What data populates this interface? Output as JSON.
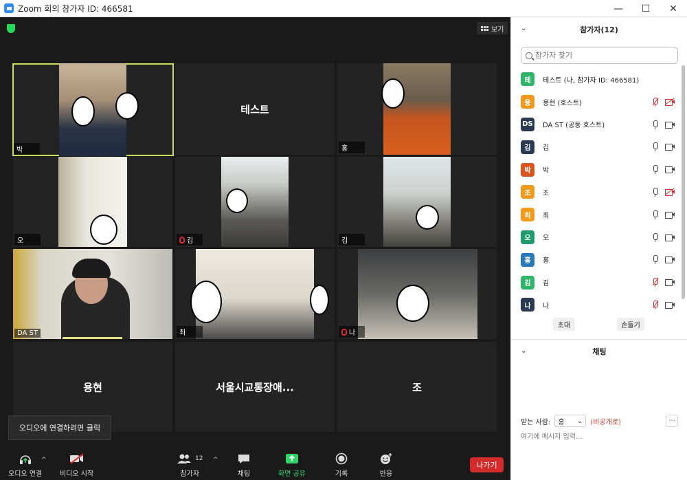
{
  "window": {
    "title": "Zoom 회의 참가자 ID: 466581",
    "controls": [
      "—",
      "☐",
      "✕"
    ]
  },
  "meeting": {
    "view_label": "보기",
    "tiles": [
      {
        "label": "박",
        "muted": false,
        "active": true,
        "type": "video"
      },
      {
        "center_name": "테스트",
        "type": "name"
      },
      {
        "label": "홍",
        "muted": false,
        "type": "video"
      },
      {
        "label": "오",
        "muted": false,
        "type": "video"
      },
      {
        "label": "김",
        "muted": true,
        "type": "video"
      },
      {
        "label": "김",
        "muted": false,
        "type": "video"
      },
      {
        "label": "DA ST",
        "muted": false,
        "type": "video",
        "talking": true
      },
      {
        "label": "최",
        "muted": false,
        "type": "video"
      },
      {
        "label": "나",
        "muted": true,
        "type": "video"
      },
      {
        "center_name": "용현",
        "type": "name"
      },
      {
        "center_name": "서울시교통장애...",
        "type": "name"
      },
      {
        "center_name": "조",
        "type": "name"
      }
    ]
  },
  "tooltip": "오디오에 연결하려면 클릭",
  "toolbar": {
    "audio": "오디오 연결",
    "video": "비디오 시작",
    "participants": "참가자",
    "participants_count": "12",
    "chat": "채팅",
    "share": "화면 공유",
    "record": "기록",
    "reactions": "반응",
    "leave": "나가기"
  },
  "panel": {
    "title": "참가자(12)",
    "search_placeholder": "참가자 찾기",
    "participants": [
      {
        "avatar": "테",
        "color": "#2fb66b",
        "name": "테스트 (나, 참가자 ID: 466581)",
        "mic": "none",
        "cam": "none"
      },
      {
        "avatar": "용",
        "color": "#f29a1b",
        "name": "용현 (호스트)",
        "mic": "off",
        "cam": "off"
      },
      {
        "avatar": "DS",
        "color": "#2a3c52",
        "name": "DA ST (공동 호스트)",
        "mic": "on",
        "cam": "on"
      },
      {
        "avatar": "김",
        "color": "#2a3c52",
        "name": "김",
        "mic": "on",
        "cam": "on"
      },
      {
        "avatar": "박",
        "color": "#d9541e",
        "name": "박",
        "mic": "on",
        "cam": "on"
      },
      {
        "avatar": "조",
        "color": "#f29a1b",
        "name": "조",
        "mic": "on",
        "cam": "off"
      },
      {
        "avatar": "최",
        "color": "#f29a1b",
        "name": "최",
        "mic": "on",
        "cam": "on"
      },
      {
        "avatar": "오",
        "color": "#1f9a6c",
        "name": "오",
        "mic": "on",
        "cam": "on"
      },
      {
        "avatar": "홍",
        "color": "#2a78b8",
        "name": "홍",
        "mic": "on",
        "cam": "on"
      },
      {
        "avatar": "김",
        "color": "#2fb66b",
        "name": "김",
        "mic": "off",
        "cam": "on"
      },
      {
        "avatar": "나",
        "color": "#2a3c52",
        "name": "나",
        "mic": "off",
        "cam": "on"
      }
    ],
    "invite": "초대",
    "raise_hand": "손들기"
  },
  "chat": {
    "title": "채팅",
    "to_label": "받는 사람:",
    "to_value": "홍",
    "private": "(비공개로)",
    "more": "···",
    "input_placeholder": "여기에 메시지 입력..."
  }
}
